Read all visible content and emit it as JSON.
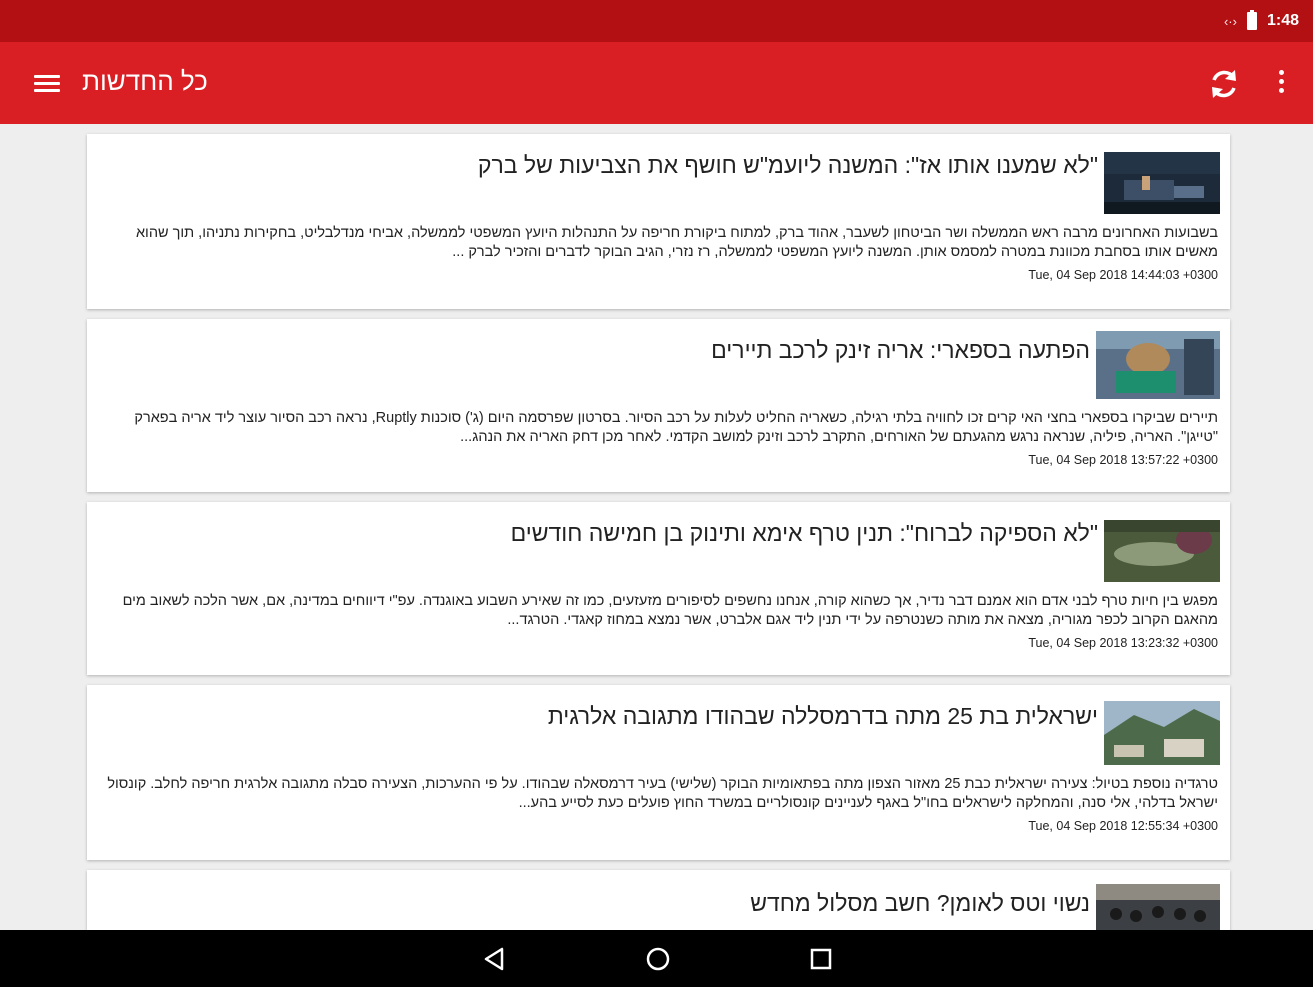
{
  "status_bar": {
    "time": "1:48",
    "signal_icon": "data-transfer-icon",
    "battery_icon": "battery-charging-icon"
  },
  "app_bar": {
    "title": "כל החדשות",
    "menu_icon": "hamburger-menu-icon",
    "refresh_icon": "refresh-icon",
    "more_icon": "more-vertical-icon"
  },
  "colors": {
    "status_bar": "#b31014",
    "app_bar": "#d91f24",
    "background": "#eeeeee",
    "card": "#ffffff",
    "nav_bar": "#000000"
  },
  "articles": [
    {
      "headline_quote": "\"לא שמענו אותו אז\":",
      "headline_rest": " המשנה ליועמ\"ש חושף את הצביעות של ברק",
      "summary": "בשבועות האחרונים מרבה ראש הממשלה ושר הביטחון לשעבר, אהוד ברק, למתוח ביקורת חריפה על התנהלות היועץ המשפטי לממשלה, אביחי מנדלבליט, בחקירות נתניהו, תוך שהוא מאשים אותו בסחבת מכוונת במטרה למסמס אותן. המשנה ליועץ המשפטי לממשלה, רז נזרי, הגיב הבוקר לדברים והזכיר לברק ...",
      "date": "Tue, 04 Sep 2018 14:44:03 +0300"
    },
    {
      "headline_quote": "הפתעה בספארי:",
      "headline_rest": " אריה זינק לרכב תיירים",
      "summary": "תיירים שביקרו בספארי בחצי האי קרים זכו לחוויה בלתי רגילה, כשאריה החליט לעלות על רכב הסיור. בסרטון שפרסמה היום (ג') סוכנות Ruptly, נראה רכב הסיור עוצר ליד אריה בפארק \"טייגן\". האריה, פיליה, שנראה נרגש מהגעתם של האורחים, התקרב לרכב וזינק למושב הקדמי. לאחר מכן דחק האריה את הנהג...",
      "date": "Tue, 04 Sep 2018 13:57:22 +0300"
    },
    {
      "headline_quote": "\"לא הספיקה לברוח\":",
      "headline_rest": " תנין טרף אימא ותינוק בן חמישה חודשים",
      "summary": "מפגש בין חיות טרף לבני אדם הוא אמנם דבר נדיר, אך כשהוא קורה, אנחנו נחשפים לסיפורים מזעזעים, כמו זה שאירע השבוע באוגנדה. עפ\"י דיווחים במדינה, אם, אשר הלכה לשאוב מים מהאגם הקרוב לכפר מגוריה, מצאה את מותה כשנטרפה על ידי תנין ליד אגם אלברט, אשר נמצא במחוז קאגדי. הטרגד...",
      "date": "Tue, 04 Sep 2018 13:23:32 +0300"
    },
    {
      "headline_quote": "",
      "headline_rest": "ישראלית בת 25 מתה בדרמסללה שבהודו מתגובה אלרגית",
      "summary": "טרגדיה נוספת בטיול: צעירה ישראלית כבת 25 מאזור הצפון מתה בפתאומיות הבוקר (שלישי) בעיר דרמסאלה שבהודו. על פי ההערכות, הצעירה סבלה מתגובה אלרגית חריפה לחלב. קונסול ישראל בדלהי, אלי סנה, והמחלקה לישראלים בחו\"ל באגף לעניינים קונסולריים במשרד החוץ פועלים כעת לסייע בהע...",
      "date": "Tue, 04 Sep 2018 12:55:34 +0300"
    },
    {
      "headline_quote": "",
      "headline_rest": "נשוי וטס לאומן? חשב מסלול מחדש",
      "summary": "",
      "date": ""
    }
  ],
  "nav_bar": {
    "back_icon": "back-triangle-icon",
    "home_icon": "home-circle-icon",
    "recents_icon": "recents-square-icon"
  }
}
